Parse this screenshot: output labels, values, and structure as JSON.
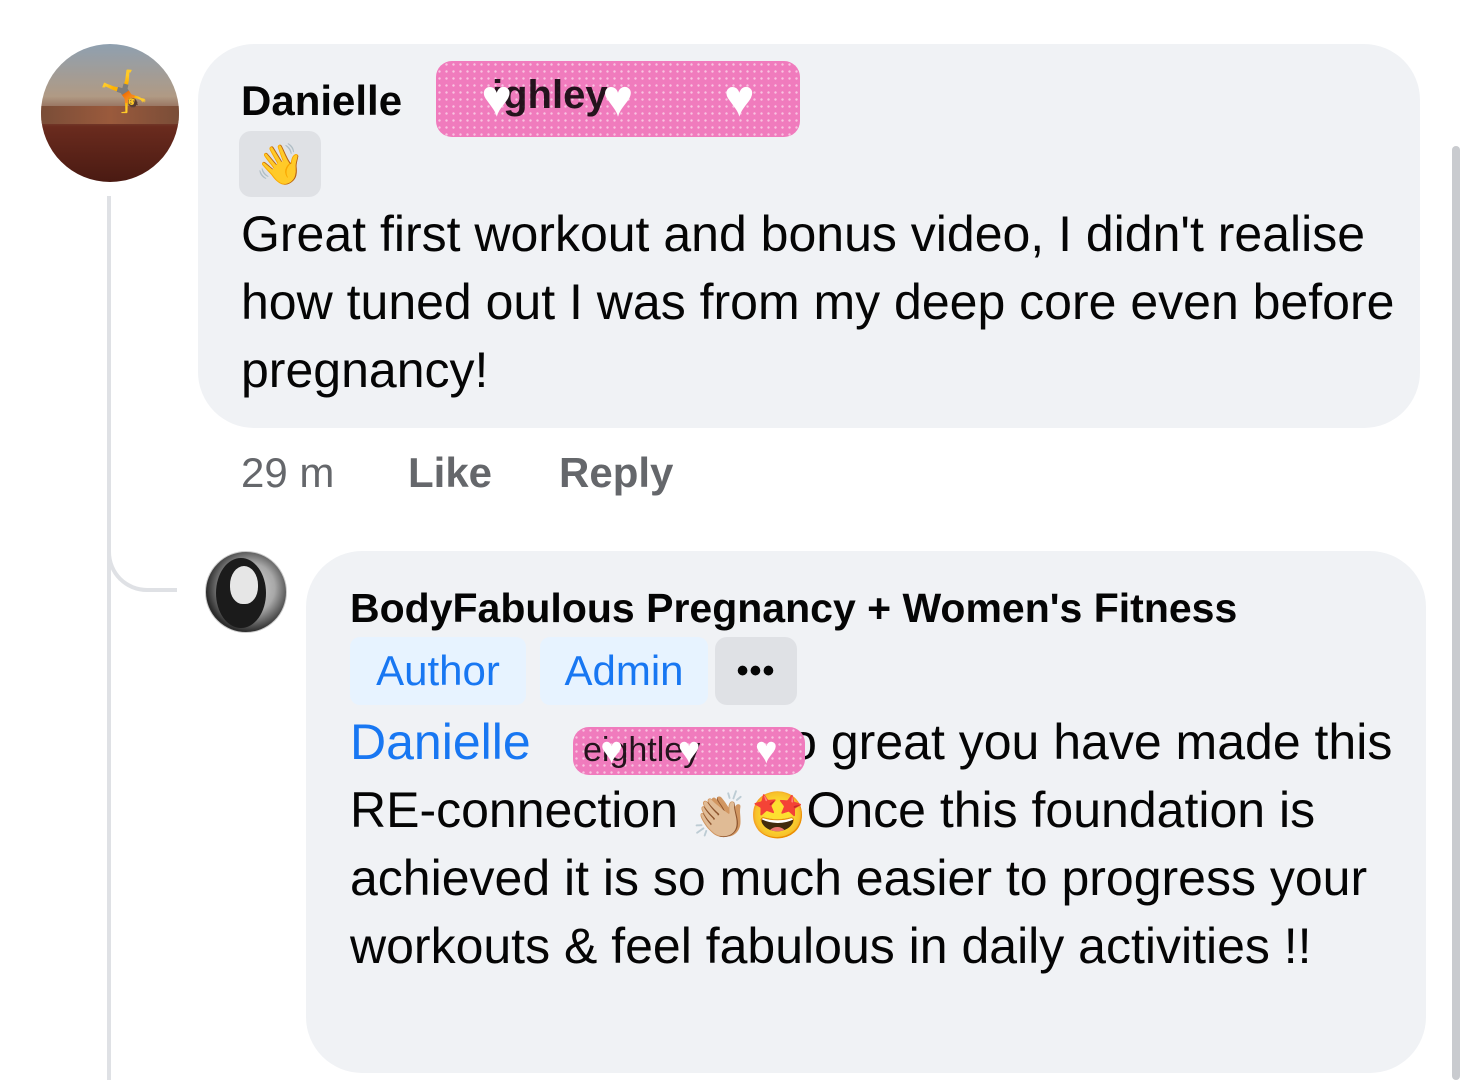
{
  "comment": {
    "author_first": "Danielle",
    "author_redacted": "ighley",
    "badge_icon": "waving-hand-icon",
    "text": "Great first workout and bonus video, I didn't realise how tuned out I was from my deep core even before pregnancy!",
    "time": "29 m",
    "like_label": "Like",
    "reply_label": "Reply"
  },
  "reply": {
    "author": "BodyFabulous Pregnancy + Women's Fitness",
    "badges": [
      "Author",
      "Admin"
    ],
    "more_label": "•••",
    "mention_first": "Danielle",
    "mention_redacted": "eightley",
    "text_part1": "so great you have made this RE-connection",
    "emoji_clap": "👏🏼",
    "emoji_star": "🤩",
    "text_part2": "Once this foundation is achieved it is so much easier to progress your workouts & feel fabulous in daily activities !!"
  },
  "colors": {
    "bubble": "#f0f2f5",
    "link_blue": "#1877f2",
    "redaction_pink": "#f07bbd",
    "meta_gray": "#65676b"
  }
}
